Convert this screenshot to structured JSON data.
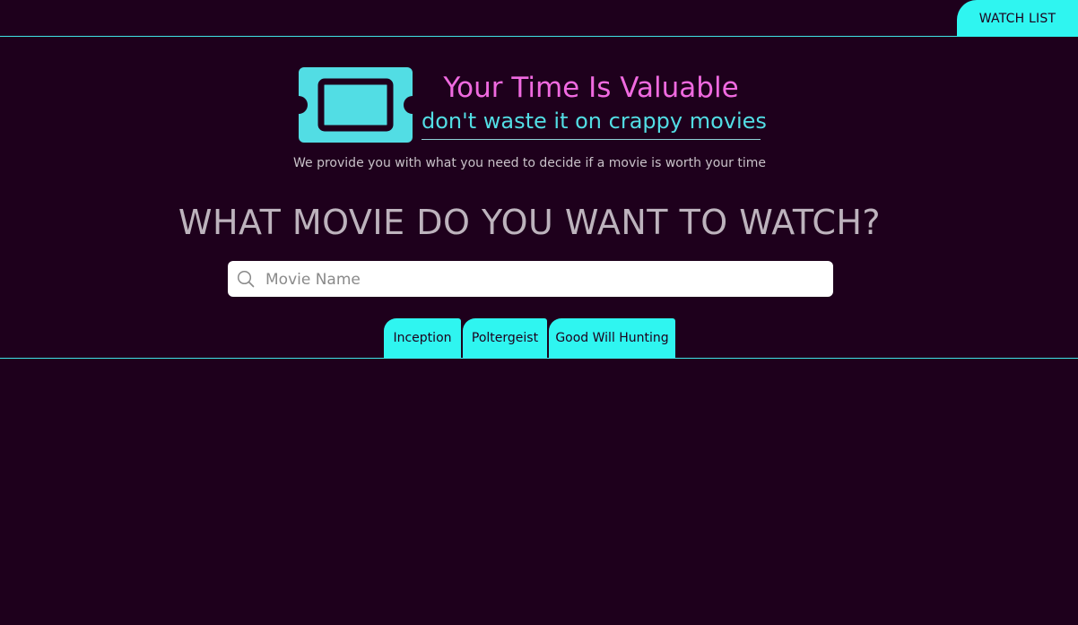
{
  "header": {
    "watch_list_label": "WATCH LIST"
  },
  "brand": {
    "logo_icon": "ticket-icon",
    "title": "Your Time Is Valuable",
    "subtitle": "don't waste it on crappy movies",
    "tagline": "We provide you with what you need to decide if a movie is worth your time"
  },
  "search": {
    "question": "WHAT MOVIE DO YOU WANT TO WATCH?",
    "icon": "search-icon",
    "placeholder": "Movie Name",
    "value": ""
  },
  "suggestions": [
    {
      "label": "Inception"
    },
    {
      "label": "Poltergeist"
    },
    {
      "label": "Good Will Hunting"
    }
  ],
  "colors": {
    "background": "#1e001c",
    "accent_cyan": "#2ff5f0",
    "title_pink": "#f06ae0",
    "subtitle_cyan": "#52dde4",
    "text_muted": "#bdb3bd"
  }
}
